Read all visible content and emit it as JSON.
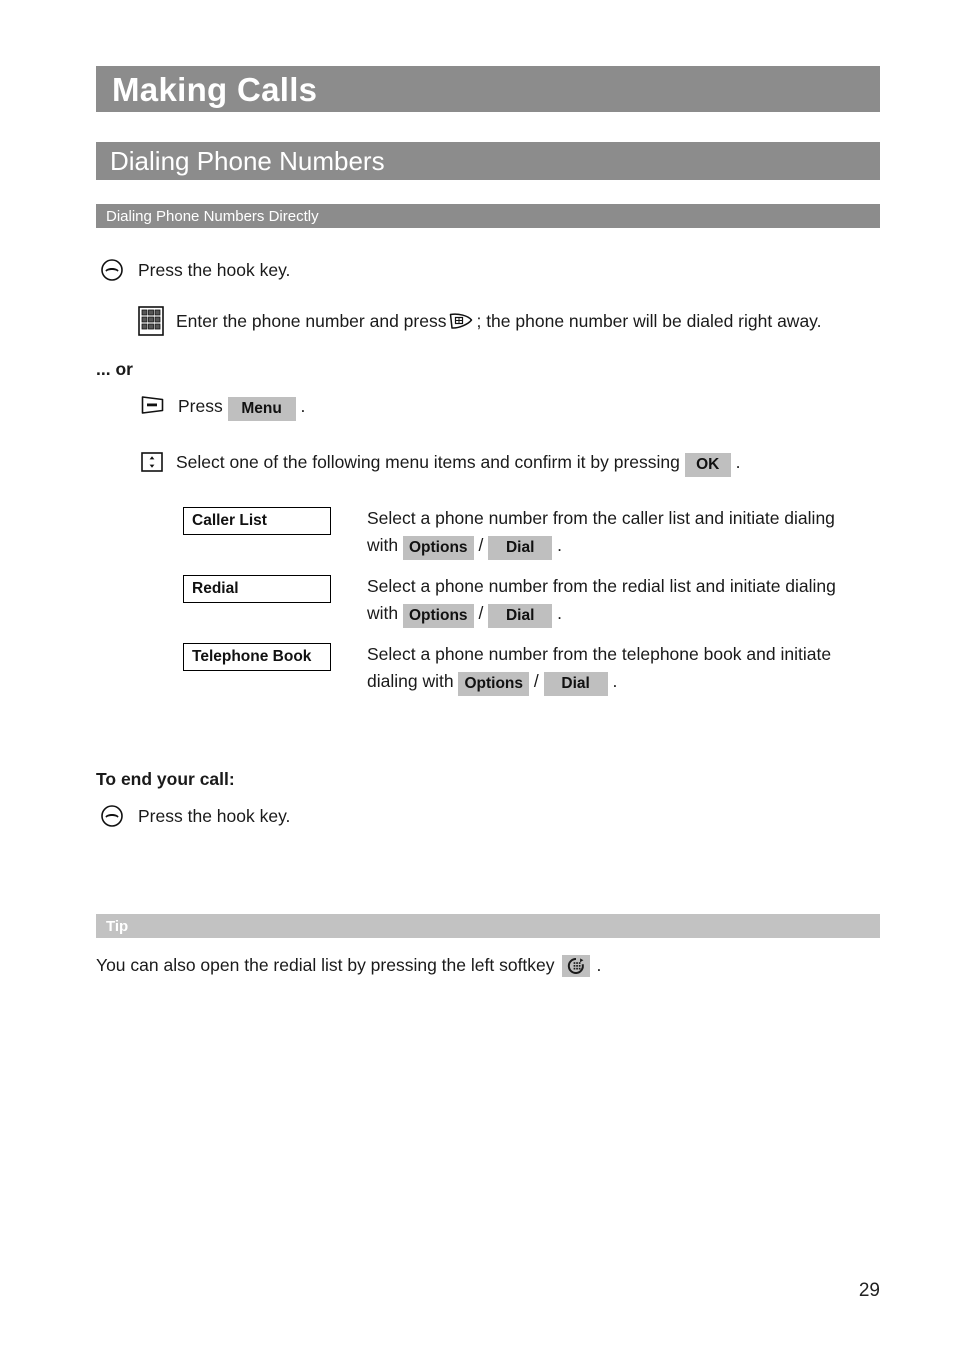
{
  "document": {
    "chapter_title": "Making Calls",
    "section_title": "Dialing Phone Numbers",
    "subsection_title": "Dialing Phone Numbers Directly",
    "page_number": "29"
  },
  "colors": {
    "bar_dark": "#8c8c8c",
    "bar_light": "#c2c2c2",
    "chip_bg": "#bfbfbf",
    "text": "#1a1a1a",
    "bar_text": "#ffffff"
  },
  "steps": {
    "hook_press": "Press the hook key.",
    "keypad_enter_pre": "Enter the phone number and press",
    "keypad_enter_post": "; the phone number will be dialed right away.",
    "or_divider": "... or",
    "press_label": "Press",
    "menu_chip": "Menu",
    "period": ".",
    "select_items_pre": "Select one of the following menu items and confirm it by pressing",
    "ok_chip": "OK"
  },
  "menu_items": [
    {
      "box_label": "Caller List",
      "desc_line1": "Select a phone number from the caller list and initiate dialing",
      "desc_line2_pre": "with",
      "chip_a": "Options",
      "separator": "/",
      "chip_b": "Dial",
      "desc_line2_post": "."
    },
    {
      "box_label": "Redial",
      "desc_line1": "Select a phone number from the redial list and initiate dialing",
      "desc_line2_pre": "with",
      "chip_a": "Options",
      "separator": "/",
      "chip_b": "Dial",
      "desc_line2_post": "."
    },
    {
      "box_label": "Telephone Book",
      "desc_line1": "Select a phone number from the telephone book and initiate",
      "desc_line2_pre": "dialing with",
      "chip_a": "Options",
      "separator": "/",
      "chip_b": "Dial",
      "desc_line2_post": "."
    }
  ],
  "end_call": {
    "heading": "To end your call:",
    "instruction": "Press the hook key."
  },
  "tip": {
    "bar_label": "Tip",
    "text_pre": "You can also open the redial list by pressing the left softkey",
    "text_post": "."
  },
  "icons": {
    "hook_key": "hook-key-icon",
    "keypad": "keypad-icon",
    "softkey_right": "right-softkey-icon",
    "softkey_left": "left-softkey-icon",
    "navigation": "navigation-key-icon",
    "redial_softkey": "redial-softkey-icon"
  }
}
